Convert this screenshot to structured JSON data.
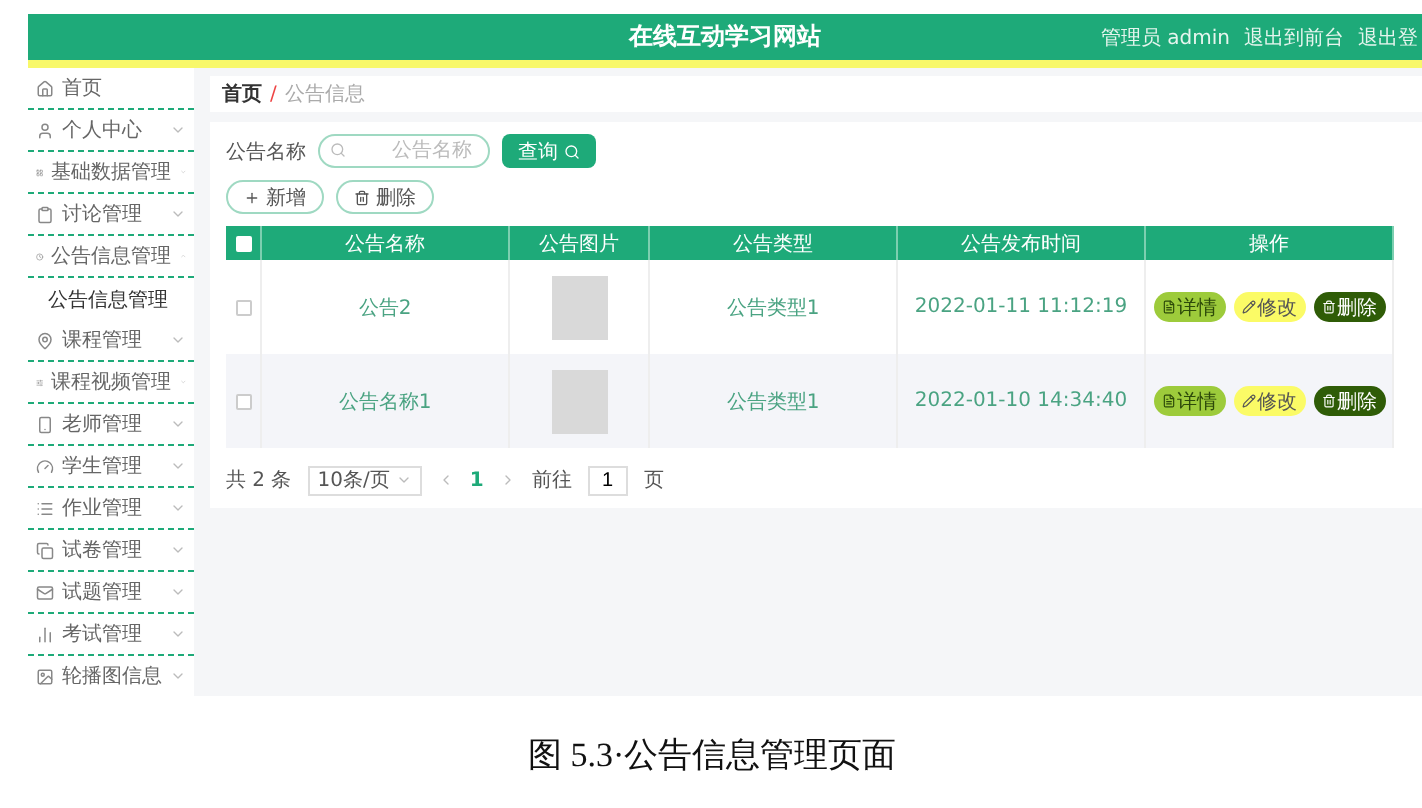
{
  "header": {
    "title": "在线互动学习网站",
    "links": [
      "管理员 admin",
      "退出到前台",
      "退出登"
    ]
  },
  "sidebar": {
    "items": [
      {
        "label": "首页",
        "kind": "link"
      },
      {
        "label": "个人中心",
        "kind": "menu",
        "expanded": false
      },
      {
        "label": "基础数据管理",
        "kind": "menu",
        "expanded": false
      },
      {
        "label": "讨论管理",
        "kind": "menu",
        "expanded": false
      },
      {
        "label": "公告信息管理",
        "kind": "menu",
        "expanded": true,
        "children": [
          {
            "label": "公告信息管理"
          }
        ]
      },
      {
        "label": "课程管理",
        "kind": "menu",
        "expanded": false
      },
      {
        "label": "课程视频管理",
        "kind": "menu",
        "expanded": false
      },
      {
        "label": "老师管理",
        "kind": "menu",
        "expanded": false
      },
      {
        "label": "学生管理",
        "kind": "menu",
        "expanded": false
      },
      {
        "label": "作业管理",
        "kind": "menu",
        "expanded": false
      },
      {
        "label": "试卷管理",
        "kind": "menu",
        "expanded": false
      },
      {
        "label": "试题管理",
        "kind": "menu",
        "expanded": false
      },
      {
        "label": "考试管理",
        "kind": "menu",
        "expanded": false
      },
      {
        "label": "轮播图信息",
        "kind": "menu",
        "expanded": false
      }
    ]
  },
  "breadcrumb": {
    "items": [
      "首页",
      "公告信息"
    ],
    "separator": "/"
  },
  "search": {
    "label": "公告名称",
    "placeholder": "公告名称",
    "button": "查询"
  },
  "actions": [
    "新增",
    "删除"
  ],
  "table": {
    "header_checked": false,
    "columns": [
      "公告名称",
      "公告图片",
      "公告类型",
      "公告发布时间",
      "操作"
    ],
    "rows": [
      {
        "checked": false,
        "name": "公告2",
        "type": "公告类型1",
        "time": "2022-01-11 11:12:19",
        "buttons": [
          {
            "kind": "detail",
            "label": "详情"
          },
          {
            "kind": "edit",
            "label": "修改"
          },
          {
            "kind": "delete",
            "label": "删除"
          }
        ]
      },
      {
        "checked": false,
        "name": "公告名称1",
        "type": "公告类型1",
        "time": "2022-01-10 14:34:40",
        "buttons": [
          {
            "kind": "detail",
            "label": "详情"
          },
          {
            "kind": "edit",
            "label": "修改"
          },
          {
            "kind": "delete",
            "label": "删除"
          }
        ]
      }
    ]
  },
  "pagination": {
    "total": "共 2 条",
    "page_size": "10条/页",
    "pages": [
      {
        "label": "1",
        "selected": true
      }
    ],
    "goto_label": "前往",
    "goto_value": "1",
    "goto_suffix": "页"
  },
  "caption": "图 5.3·公告信息管理页面"
}
